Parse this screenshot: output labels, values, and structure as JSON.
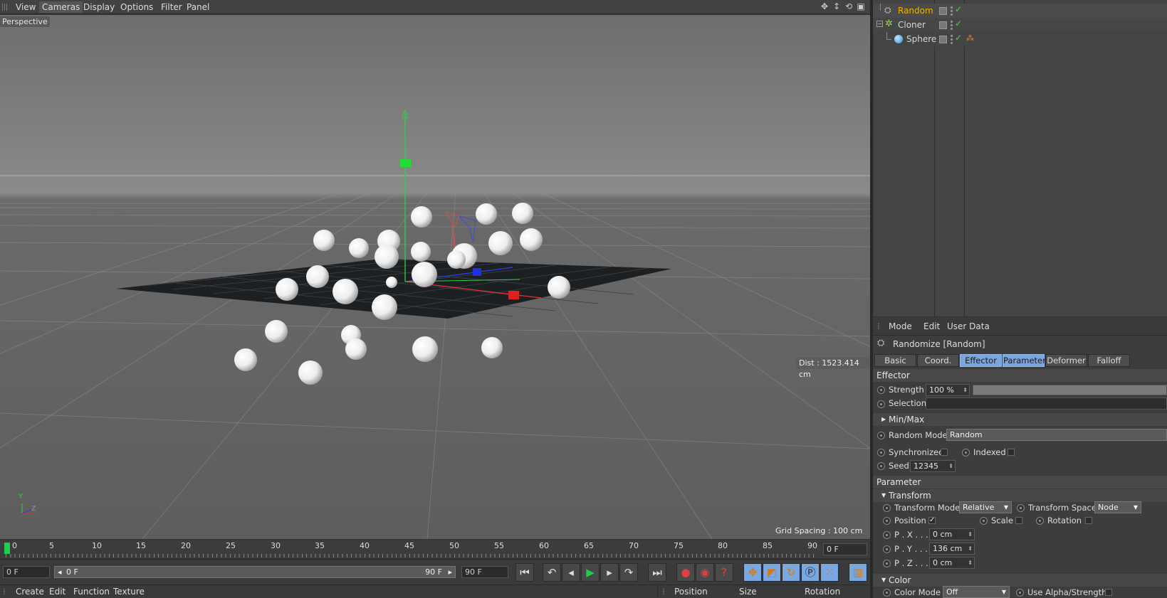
{
  "viewport": {
    "menu": [
      "View",
      "Cameras",
      "Display",
      "Options",
      "Filter",
      "Panel"
    ],
    "camera_label": "Perspective",
    "dist": "Dist : 1523.414 cm",
    "grid_spacing": "Grid Spacing : 100 cm",
    "axis_y": "Y",
    "axis_z": "Z"
  },
  "timeline": {
    "ticks": [
      "0",
      "5",
      "10",
      "15",
      "20",
      "25",
      "30",
      "35",
      "40",
      "45",
      "50",
      "55",
      "60",
      "65",
      "70",
      "75",
      "80",
      "85",
      "90"
    ],
    "end_field": "0 F"
  },
  "transport": {
    "current_frame": "0 F",
    "range_start": "0 F",
    "range_end": "90 F",
    "max_frame": "90 F"
  },
  "bottom_menu": [
    "Create",
    "Edit",
    "Function",
    "Texture"
  ],
  "coords_headers": [
    "Position",
    "Size",
    "Rotation"
  ],
  "object_manager": {
    "objects": [
      {
        "name": "Random",
        "icon": "random-effector-icon",
        "color": "#f0b400"
      },
      {
        "name": "Cloner",
        "icon": "cloner-icon",
        "color": "#cfd8dc"
      },
      {
        "name": "Sphere",
        "icon": "sphere-icon",
        "color": "#cfd8dc"
      }
    ]
  },
  "attr": {
    "menu": [
      "Mode",
      "Edit",
      "User Data"
    ],
    "title": "Randomize [Random]",
    "tabs": [
      "Basic",
      "Coord.",
      "Effector",
      "Parameter",
      "Deformer",
      "Falloff"
    ],
    "effector_header": "Effector",
    "strength_label": "Strength",
    "strength_value": "100 %",
    "selection_label": "Selection",
    "minmax_label": "Min/Max",
    "random_mode_label": "Random Mode",
    "random_mode_value": "Random",
    "synchronized_label": "Synchronized",
    "indexed_label": "Indexed",
    "seed_label": "Seed",
    "seed_value": "12345",
    "parameter_header": "Parameter",
    "transform_label": "Transform",
    "transform_mode_label": "Transform Mode",
    "transform_mode_value": "Relative",
    "transform_space_label": "Transform Space",
    "transform_space_value": "Node",
    "position_label": "Position",
    "scale_label": "Scale",
    "rotation_label": "Rotation",
    "px_label": "P . X . . .",
    "px_value": "0 cm",
    "py_label": "P . Y . . .",
    "py_value": "136 cm",
    "pz_label": "P . Z . . .",
    "pz_value": "0 cm",
    "color_label": "Color",
    "color_mode_label": "Color Mode",
    "color_mode_value": "Off",
    "use_alpha_label": "Use Alpha/Strength"
  }
}
